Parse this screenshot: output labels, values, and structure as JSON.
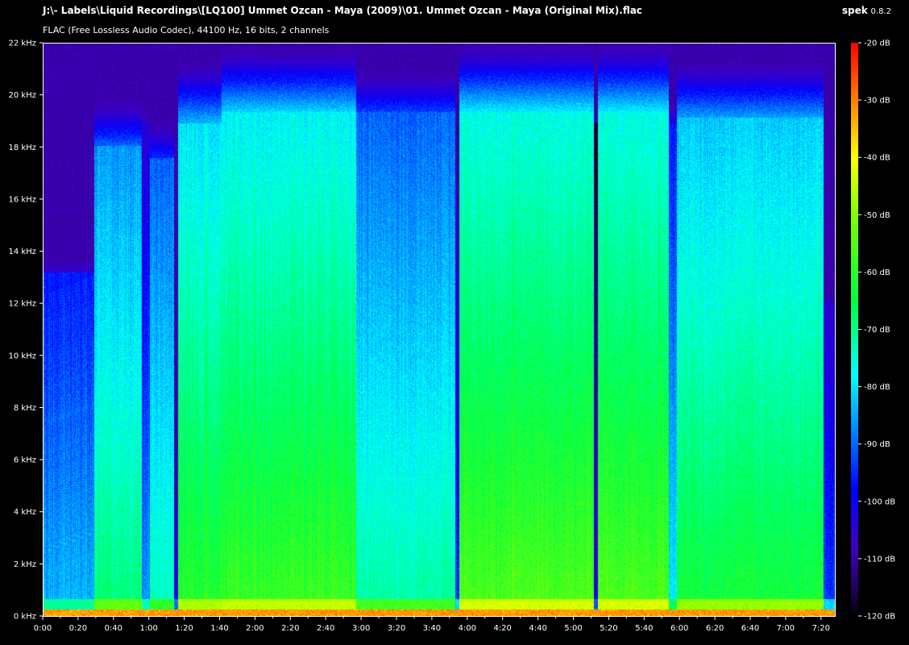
{
  "header": {
    "file_path": "J:\\- Labels\\Liquid Recordings\\[LQ100] Ummet Ozcan - Maya (2009)\\01. Ummet Ozcan - Maya (Original Mix).flac",
    "app_name": "spek",
    "app_version": "0.8.2",
    "audio_info": "FLAC (Free Lossless Audio Codec), 44100 Hz, 16 bits, 2 channels"
  },
  "axes": {
    "freq_labels": [
      "22 kHz",
      "20 kHz",
      "18 kHz",
      "16 kHz",
      "14 kHz",
      "12 kHz",
      "10 kHz",
      "8 kHz",
      "6 kHz",
      "4 kHz",
      "2 kHz",
      "0 kHz"
    ],
    "time_labels": [
      "0:00",
      "0:20",
      "0:40",
      "1:00",
      "1:20",
      "1:40",
      "2:00",
      "2:20",
      "2:40",
      "3:00",
      "3:20",
      "3:40",
      "4:00",
      "4:20",
      "4:40",
      "5:00",
      "5:20",
      "5:40",
      "6:00",
      "6:20",
      "6:40",
      "7:00",
      "7:20"
    ],
    "db_labels": [
      "-20 dB",
      "-30 dB",
      "-40 dB",
      "-50 dB",
      "-60 dB",
      "-70 dB",
      "-80 dB",
      "-90 dB",
      "-100 dB",
      "-110 dB",
      "-120 dB"
    ]
  },
  "colors": {
    "background": "#000000",
    "scale": [
      "#ff0000",
      "#ff8000",
      "#ffff00",
      "#80ff00",
      "#00ff40",
      "#00ffff",
      "#0080ff",
      "#0000ff",
      "#4000c0",
      "#200060",
      "#000000"
    ]
  }
}
